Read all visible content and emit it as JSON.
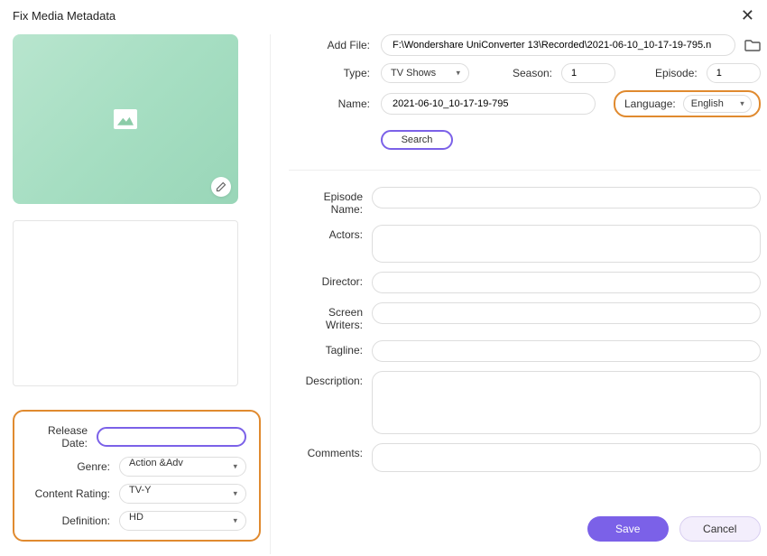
{
  "header": {
    "title": "Fix Media Metadata"
  },
  "left": {
    "release_date_label": "Release Date:",
    "release_date_value": "",
    "genre_label": "Genre:",
    "genre_value": "Action &Adv",
    "content_rating_label": "Content Rating:",
    "content_rating_value": "TV-Y",
    "definition_label": "Definition:",
    "definition_value": "HD"
  },
  "form": {
    "add_file_label": "Add File:",
    "add_file_value": "F:\\Wondershare UniConverter 13\\Recorded\\2021-06-10_10-17-19-795.n",
    "type_label": "Type:",
    "type_value": "TV Shows",
    "season_label": "Season:",
    "season_value": "1",
    "episode_label": "Episode:",
    "episode_value": "1",
    "name_label": "Name:",
    "name_value": "2021-06-10_10-17-19-795",
    "language_label": "Language:",
    "language_value": "English",
    "search_label": "Search",
    "episode_name_label": "Episode Name:",
    "episode_name_value": "",
    "actors_label": "Actors:",
    "actors_value": "",
    "director_label": "Director:",
    "director_value": "",
    "screen_writers_label": "Screen Writers:",
    "screen_writers_value": "",
    "tagline_label": "Tagline:",
    "tagline_value": "",
    "description_label": "Description:",
    "description_value": "",
    "comments_label": "Comments:",
    "comments_value": ""
  },
  "footer": {
    "save": "Save",
    "cancel": "Cancel"
  }
}
